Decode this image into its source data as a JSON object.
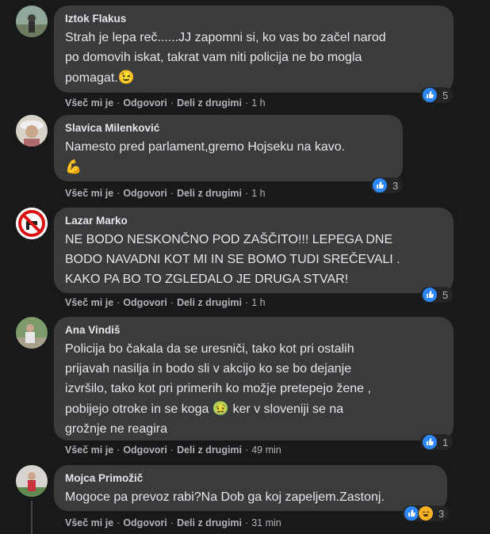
{
  "actions": {
    "like": "Všeč mi je",
    "reply": "Odgovori",
    "share": "Deli z drugimi",
    "sep": "·"
  },
  "comments": [
    {
      "name": "Iztok Flakus",
      "lines": [
        "Strah je lepa reč......JJ zapomni si, ko vas bo začel narod",
        "po domovih iskat, takrat vam niti policija ne bo mogla",
        "pomagat."
      ],
      "emoji": "😉",
      "time": "1 h",
      "reactions": "5"
    },
    {
      "name": "Slavica Milenković",
      "lines": [
        "Namesto pred parlament,gremo Hojseku na kavo."
      ],
      "emoji": "💪",
      "time": "1 h",
      "reactions": "3"
    },
    {
      "name": "Lazar Marko",
      "lines": [
        "NE BODO NESKONČNO POD ZAŠČITO!!! LEPEGA DNE",
        "BODO NAVADNI KOT MI IN SE BOMO TUDI SREČEVALI .",
        "KAKO PA BO TO ZGLEDALO JE DRUGA STVAR!"
      ],
      "time": "1 h",
      "reactions": "5"
    },
    {
      "name": "Ana Vindiš",
      "lines": [
        "Policija bo čakala da se uresniči, tako kot pri ostalih",
        "prijavah nasilja in bodo sli v akcijo ko se bo dejanje",
        "izvršilo, tako kot pri primerih ko možje pretepejo žene ,"
      ],
      "line4_a": "pobijejo otroke in se koga",
      "line4_emoji": "🤢",
      "line4_b": "ker v sloveniji se na",
      "line5": "grožnje ne reagira",
      "time": "49 min",
      "reactions": "1"
    },
    {
      "name": "Mojca Primožič",
      "lines": [
        "Mogoce pa prevoz rabi?Na Dob ga koj zapeljem.Zastonj."
      ],
      "time": "31 min",
      "reactions": "3"
    }
  ]
}
